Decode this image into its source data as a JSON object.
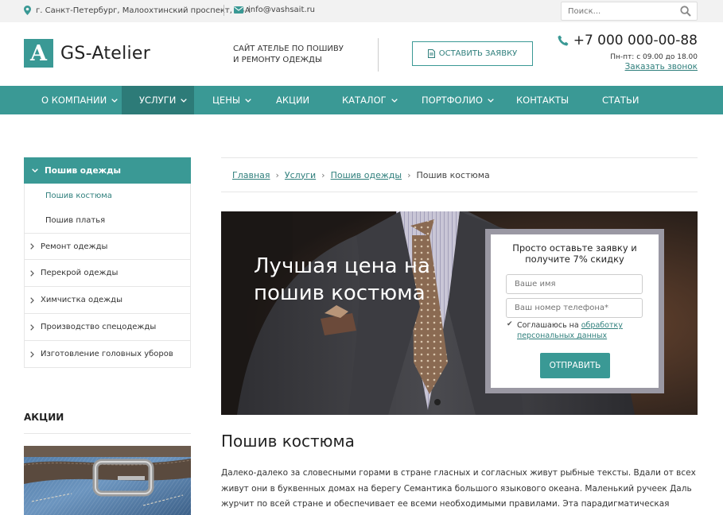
{
  "topbar": {
    "address": "г. Санкт-Петербург, Малоохтинский проспект, 64А",
    "email": "info@vashsait.ru",
    "search_placeholder": "Поиск..."
  },
  "header": {
    "logo_letter": "A",
    "logo_name": "GS-Atelier",
    "tagline_1": "САЙТ АТЕЛЬЕ ПО ПОШИВУ",
    "tagline_2": "И РЕМОНТУ ОДЕЖДЫ",
    "order_button": "ОСТАВИТЬ ЗАЯВКУ",
    "phone": "+7 000 000-00-88",
    "hours": "Пн-пт: с 09.00 до 18.00",
    "callback": "Заказать звонок"
  },
  "nav": [
    {
      "label": "О КОМПАНИИ"
    },
    {
      "label": "УСЛУГИ"
    },
    {
      "label": "ЦЕНЫ"
    },
    {
      "label": "АКЦИИ"
    },
    {
      "label": "КАТАЛОГ"
    },
    {
      "label": "ПОРТФОЛИО"
    },
    {
      "label": "КОНТАКТЫ"
    },
    {
      "label": "СТАТЬИ"
    }
  ],
  "sidebar": {
    "head": "Пошив одежды",
    "subitems": [
      "Пошив костюма",
      "Пошив платья"
    ],
    "items": [
      "Ремонт одежды",
      "Перекрой одежды",
      "Химчистка одежды",
      "Производство спецодежды",
      "Изготовление головных уборов"
    ],
    "promo_title": "АКЦИИ"
  },
  "breadcrumb": {
    "home": "Главная",
    "services": "Услуги",
    "tailoring": "Пошив одежды",
    "current": "Пошив костюма"
  },
  "hero": {
    "title_1": "Лучшая цена на",
    "title_2": "пошив костюма"
  },
  "form": {
    "title_1": "Просто оставьте заявку и",
    "title_2": "получите 7% скидку",
    "name_placeholder": "Ваше имя",
    "phone_placeholder": "Ваш номер телефона*",
    "agree_text": "Соглашаюсь на ",
    "agree_link_1": "обработку",
    "agree_link_2": "персональных данных",
    "submit": "ОТПРАВИТЬ"
  },
  "content": {
    "heading": "Пошив костюма",
    "paragraph": "Далеко-далеко за словесными горами в стране гласных и согласных живут рыбные тексты. Вдали от всех живут они в буквенных домах на берегу Семантика большого языкового океана. Маленький ручеек Даль журчит по всей стране и обеспечивает ее всеми необходимыми правилами. Эта парадигматическая страна, в которой жаренные члены предложения залетают прямо в рот. Даже всемогущая пунктуация не"
  },
  "colors": {
    "accent": "#3a9995",
    "accent_dark": "#2d7b78"
  }
}
